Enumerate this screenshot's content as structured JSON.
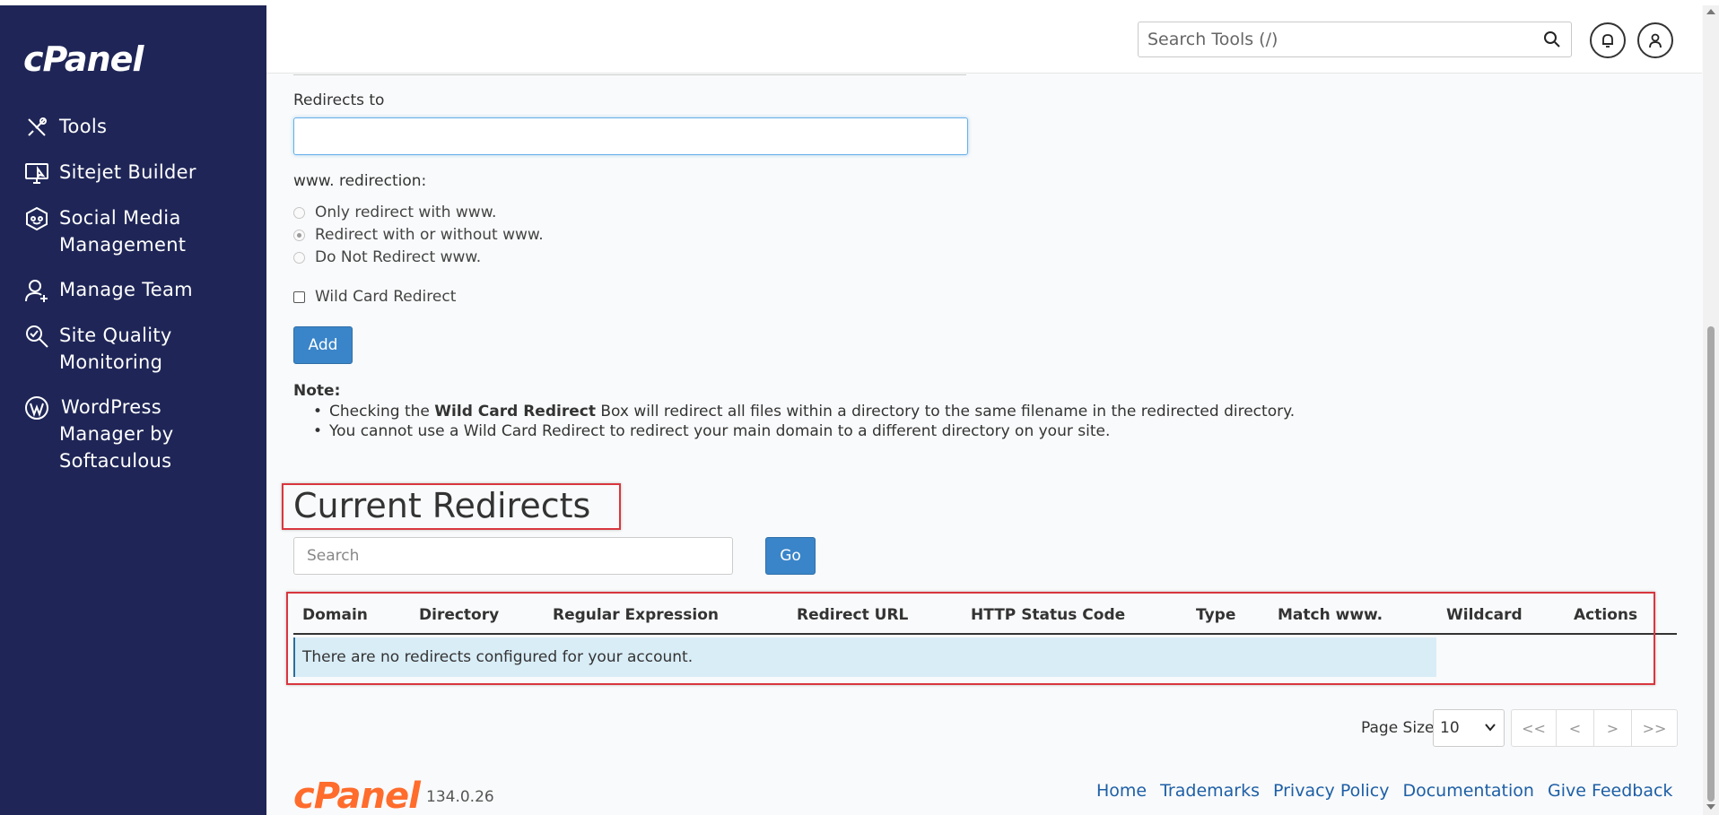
{
  "brand": {
    "logo_text": "cPanel",
    "accent": "#1f2657",
    "footer_logo_color": "#ff6c2c"
  },
  "sidebar": {
    "items": [
      {
        "label": "Tools",
        "icon": "tools-icon"
      },
      {
        "label": "Sitejet Builder",
        "icon": "monitor-icon"
      },
      {
        "label": "Social Media Management",
        "icon": "social-icon"
      },
      {
        "label": "Manage Team",
        "icon": "user-add-icon"
      },
      {
        "label": "Site Quality Monitoring",
        "icon": "magnifier-check-icon"
      },
      {
        "label": "WordPress Manager by Softaculous",
        "icon": "wordpress-icon"
      }
    ]
  },
  "header": {
    "search_placeholder": "Search Tools (/)"
  },
  "form": {
    "redirects_to_label": "Redirects to",
    "redirects_to_value": "",
    "www_label": "www. redirection:",
    "www_options": [
      {
        "label": "Only redirect with www.",
        "checked": false
      },
      {
        "label": "Redirect with or without www.",
        "checked": true
      },
      {
        "label": "Do Not Redirect www.",
        "checked": false
      }
    ],
    "wildcard_label": "Wild Card Redirect",
    "add_button": "Add"
  },
  "note": {
    "title": "Note:",
    "line1_prefix": "Checking the ",
    "line1_bold": "Wild Card Redirect",
    "line1_suffix": " Box will redirect all files within a directory to the same filename in the redirected directory.",
    "line2": "You cannot use a Wild Card Redirect to redirect your main domain to a different directory on your site."
  },
  "current": {
    "title": "Current Redirects",
    "search_placeholder": "Search",
    "go_button": "Go",
    "columns": [
      "Domain",
      "Directory",
      "Regular Expression",
      "Redirect URL",
      "HTTP Status Code",
      "Type",
      "Match www.",
      "Wildcard",
      "Actions"
    ],
    "empty_message": "There are no redirects configured for your account."
  },
  "pagination": {
    "page_size_label": "Page Size",
    "page_size_value": "10",
    "buttons": [
      "<<",
      "<",
      ">",
      ">>"
    ]
  },
  "footer": {
    "logo_text": "cPanel",
    "version": "134.0.26",
    "links": [
      "Home",
      "Trademarks",
      "Privacy Policy",
      "Documentation",
      "Give Feedback"
    ]
  }
}
